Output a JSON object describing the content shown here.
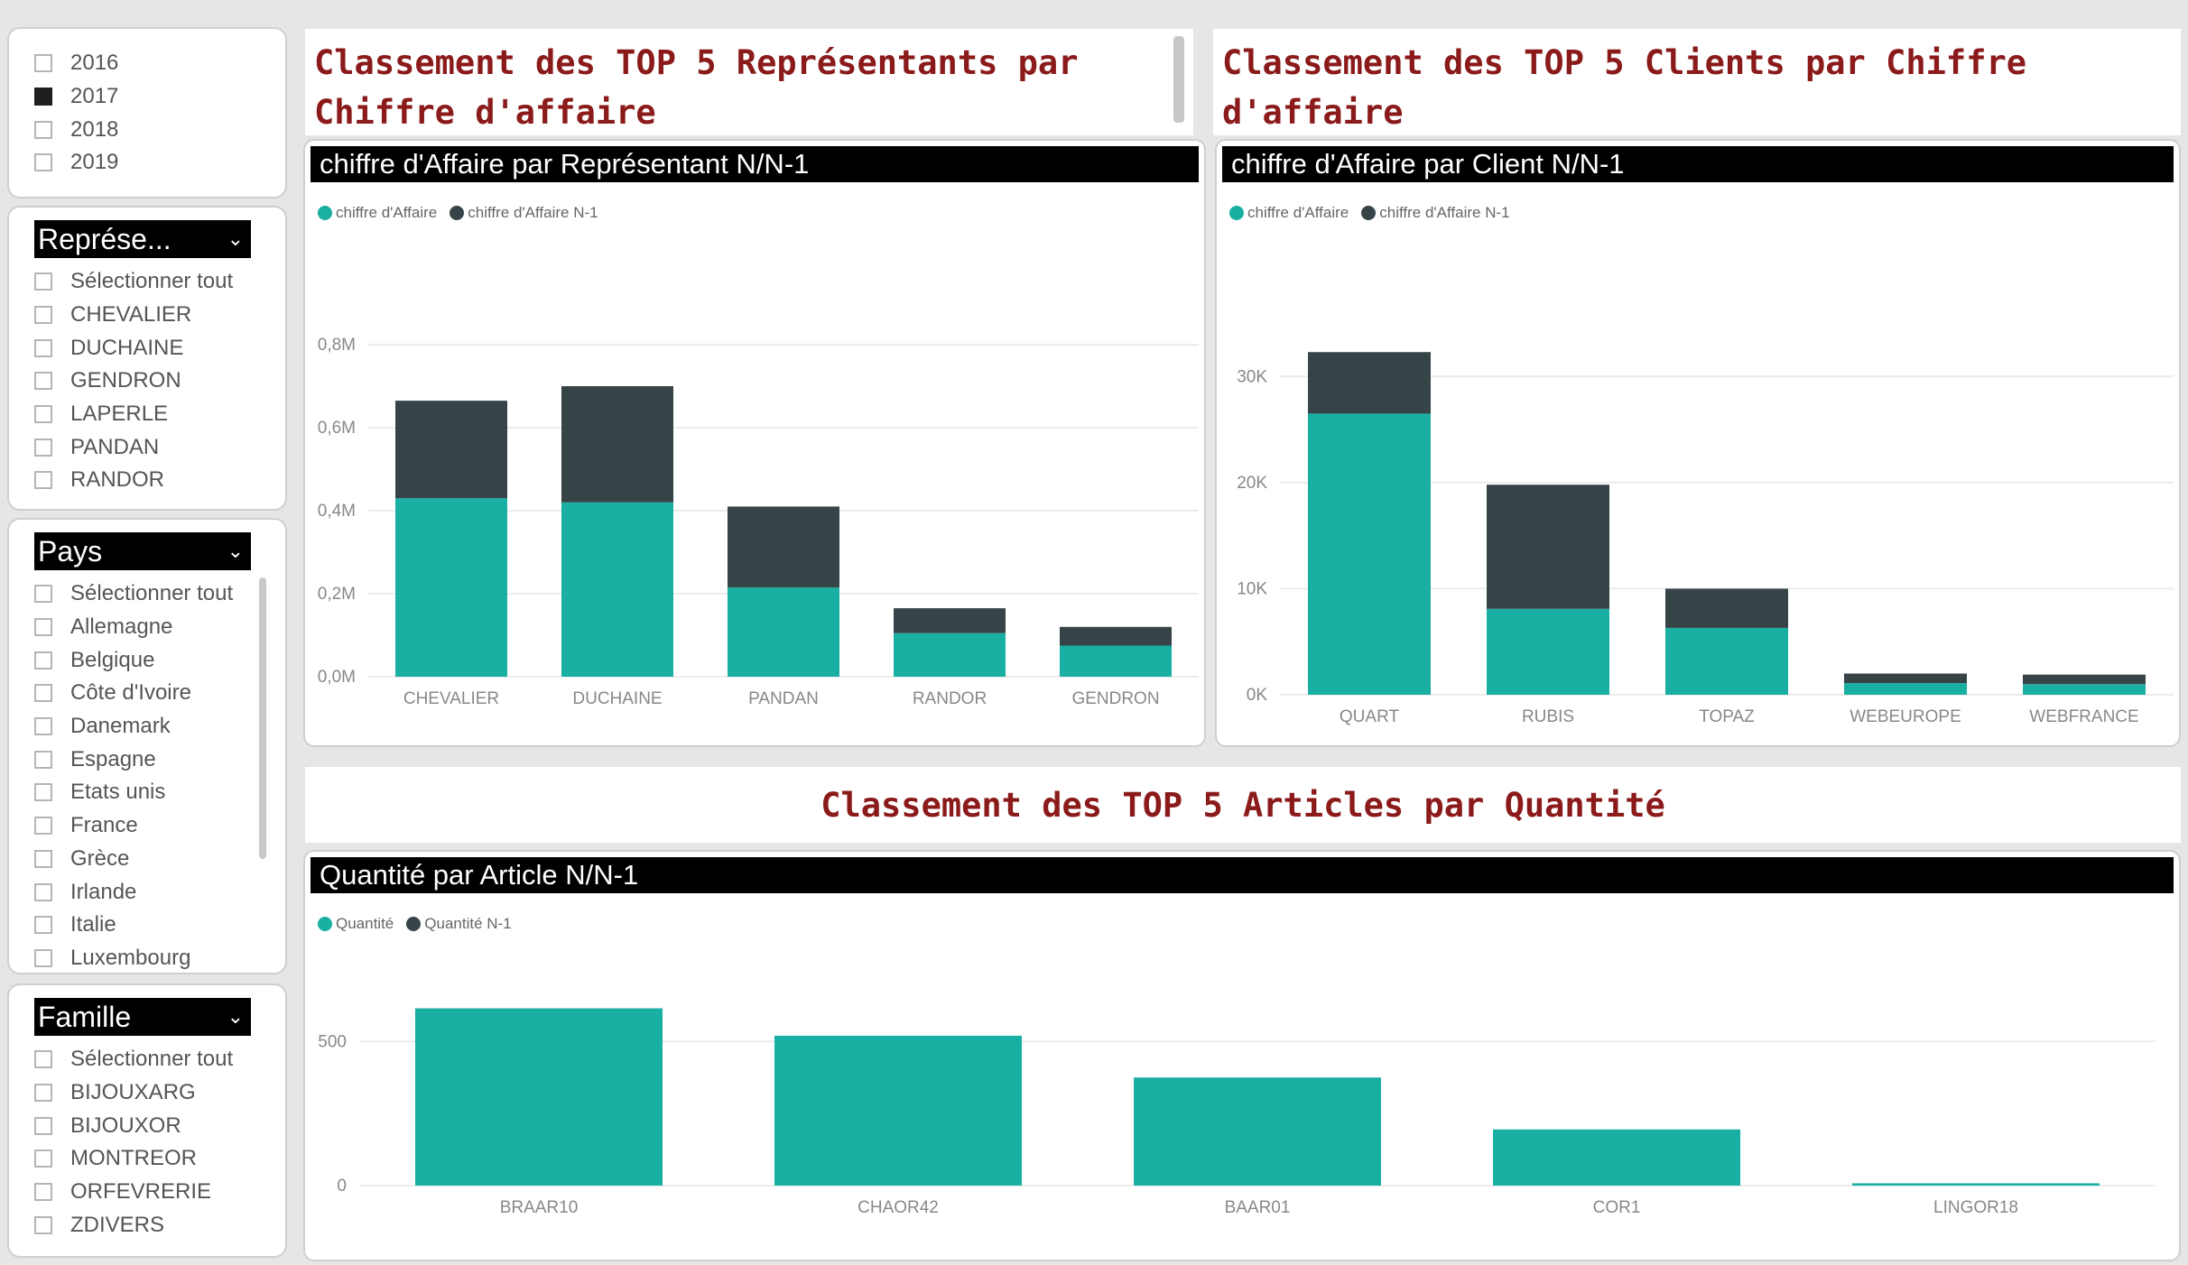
{
  "colors": {
    "current": "#1aafa3",
    "previous": "#374447",
    "title": "#8b1a1a"
  },
  "year_slicer": {
    "items": [
      {
        "label": "2016",
        "checked": false
      },
      {
        "label": "2017",
        "checked": true
      },
      {
        "label": "2018",
        "checked": false
      },
      {
        "label": "2019",
        "checked": false
      }
    ]
  },
  "rep_slicer": {
    "header": "Représe...",
    "items": [
      "Sélectionner tout",
      "CHEVALIER",
      "DUCHAINE",
      "GENDRON",
      "LAPERLE",
      "PANDAN",
      "RANDOR"
    ]
  },
  "pays_slicer": {
    "header": "Pays",
    "items": [
      "Sélectionner tout",
      "Allemagne",
      "Belgique",
      "Côte d'Ivoire",
      "Danemark",
      "Espagne",
      "Etats unis",
      "France",
      "Grèce",
      "Irlande",
      "Italie",
      "Luxembourg"
    ]
  },
  "famille_slicer": {
    "header": "Famille",
    "items": [
      "Sélectionner tout",
      "BIJOUXARG",
      "BIJOUXOR",
      "MONTREOR",
      "ORFEVRERIE",
      "ZDIVERS"
    ]
  },
  "titles": {
    "reps": "Classement des TOP 5 Représentants par Chiffre d'affaire",
    "clients": "Classement des TOP 5 Clients par Chiffre d'affaire",
    "articles": "Classement des TOP 5 Articles par Quantité"
  },
  "chart_data": [
    {
      "type": "bar",
      "title": "chiffre d'Affaire  par Représentant N/N-1",
      "stacked": true,
      "categories": [
        "CHEVALIER",
        "DUCHAINE",
        "PANDAN",
        "RANDOR",
        "GENDRON"
      ],
      "series": [
        {
          "name": "chiffre d'Affaire",
          "values": [
            0.43,
            0.42,
            0.215,
            0.105,
            0.075
          ]
        },
        {
          "name": "chiffre d'Affaire N-1",
          "values": [
            0.235,
            0.28,
            0.195,
            0.06,
            0.045
          ]
        }
      ],
      "ylim": [
        0,
        0.8
      ],
      "yticks": [
        0,
        0.2,
        0.4,
        0.6,
        0.8
      ],
      "ytick_labels": [
        "0,0M",
        "0,2M",
        "0,4M",
        "0,6M",
        "0,8M"
      ],
      "grid": true,
      "legend": "top-left"
    },
    {
      "type": "bar",
      "title": "chiffre d'Affaire par Client N/N-1",
      "stacked": true,
      "categories": [
        "QUART",
        "RUBIS",
        "TOPAZ",
        "WEBEUROPE",
        "WEBFRANCE"
      ],
      "series": [
        {
          "name": "chiffre d'Affaire",
          "values": [
            26500,
            8100,
            6300,
            1100,
            1000
          ]
        },
        {
          "name": "chiffre d'Affaire N-1",
          "values": [
            5800,
            11700,
            3700,
            900,
            900
          ]
        }
      ],
      "ylim": [
        0,
        33000
      ],
      "yticks": [
        0,
        10000,
        20000,
        30000
      ],
      "ytick_labels": [
        "0K",
        "10K",
        "20K",
        "30K"
      ],
      "grid": true,
      "legend": "top-left"
    },
    {
      "type": "bar",
      "title": "Quantité par Article N/N-1",
      "stacked": true,
      "categories": [
        "BRAAR10",
        "CHAOR42",
        "BAAR01",
        "COR1",
        "LINGOR18"
      ],
      "series": [
        {
          "name": "Quantité",
          "values": [
            615,
            520,
            375,
            195,
            8
          ]
        },
        {
          "name": "Quantité N-1",
          "values": [
            0,
            0,
            0,
            0,
            0
          ]
        }
      ],
      "ylim": [
        0,
        720
      ],
      "yticks": [
        0,
        500
      ],
      "ytick_labels": [
        "0",
        "500"
      ],
      "grid": true,
      "legend": "top-left"
    }
  ]
}
